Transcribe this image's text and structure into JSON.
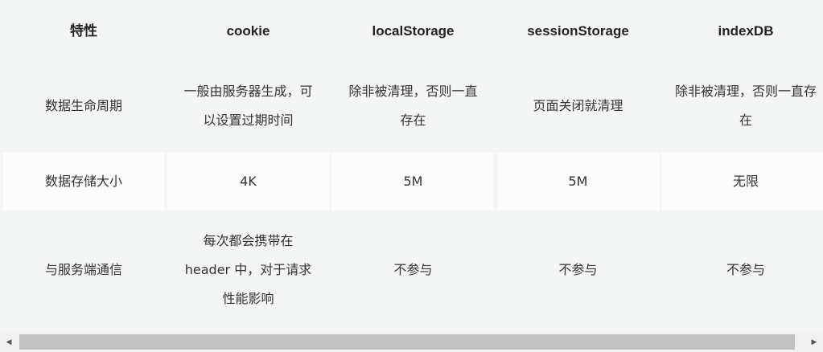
{
  "table": {
    "headers": [
      "特性",
      "cookie",
      "localStorage",
      "sessionStorage",
      "indexDB"
    ],
    "rows": [
      [
        "数据生命周期",
        "一般由服务器生成，可以设置过期时间",
        "除非被清理，否则一直存在",
        "页面关闭就清理",
        "除非被清理，否则一直存在"
      ],
      [
        "数据存储大小",
        "4K",
        "5M",
        "5M",
        "无限"
      ],
      [
        "与服务端通信",
        "每次都会携带在 header 中，对于请求性能影响",
        "不参与",
        "不参与",
        "不参与"
      ]
    ]
  },
  "scrollbar": {
    "left_arrow": "◀",
    "right_arrow": "▶"
  }
}
